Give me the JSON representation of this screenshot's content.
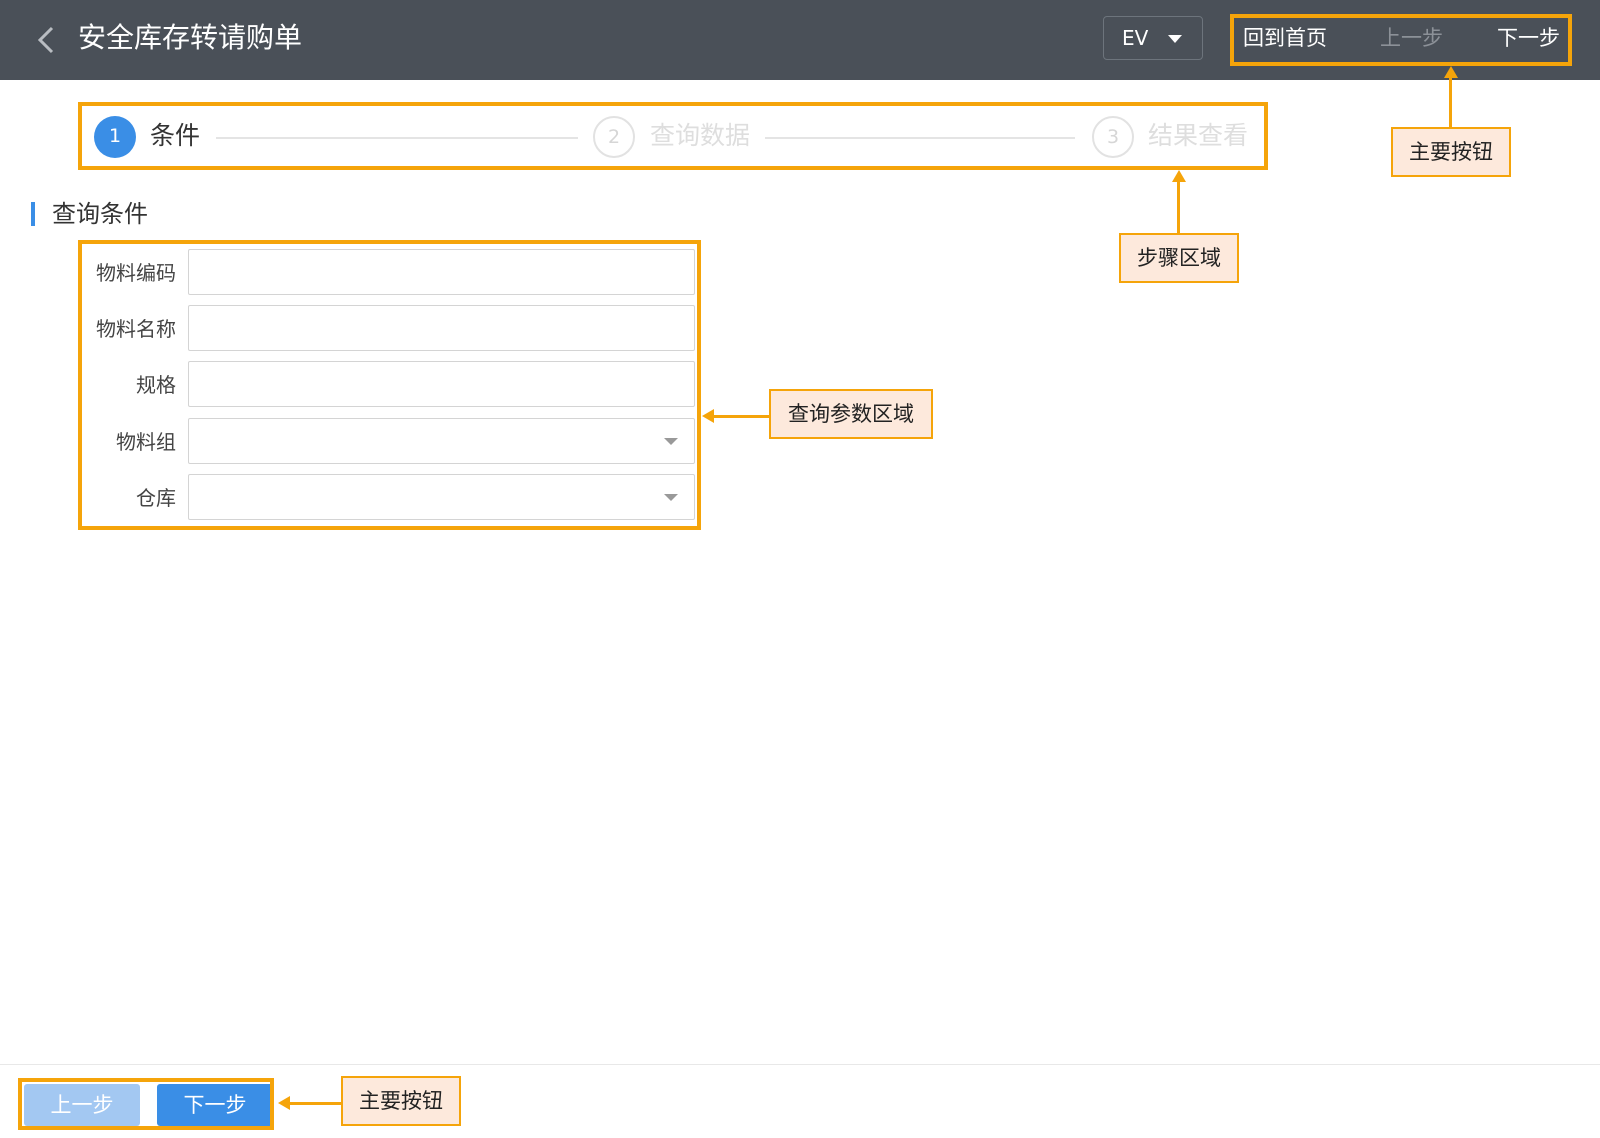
{
  "header": {
    "title": "安全库存转请购单",
    "language": "EV",
    "buttons": {
      "home": "回到首页",
      "prev": "上一步",
      "next": "下一步"
    }
  },
  "steps": [
    {
      "number": "1",
      "label": "条件",
      "state": "active"
    },
    {
      "number": "2",
      "label": "查询数据",
      "state": "pending"
    },
    {
      "number": "3",
      "label": "结果查看",
      "state": "pending"
    }
  ],
  "section": {
    "title": "查询条件"
  },
  "form": {
    "fields": [
      {
        "label": "物料编码",
        "value": ""
      },
      {
        "label": "物料名称",
        "value": ""
      },
      {
        "label": "规格",
        "value": ""
      },
      {
        "label": "物料组",
        "value": ""
      },
      {
        "label": "仓库",
        "value": ""
      }
    ]
  },
  "footer": {
    "prev": "上一步",
    "next": "下一步"
  },
  "annotations": {
    "main_buttons_top": "主要按钮",
    "steps_area": "步骤区域",
    "query_params_area": "查询参数区域",
    "main_buttons_bottom": "主要按钮"
  },
  "colors": {
    "header_bg": "#4a5058",
    "accent": "#3a8ee6",
    "highlight": "#f5a40a",
    "callout_bg": "#fde9dc"
  },
  "icons": {
    "back": "chevron-left-icon",
    "dropdown": "caret-down-icon"
  }
}
